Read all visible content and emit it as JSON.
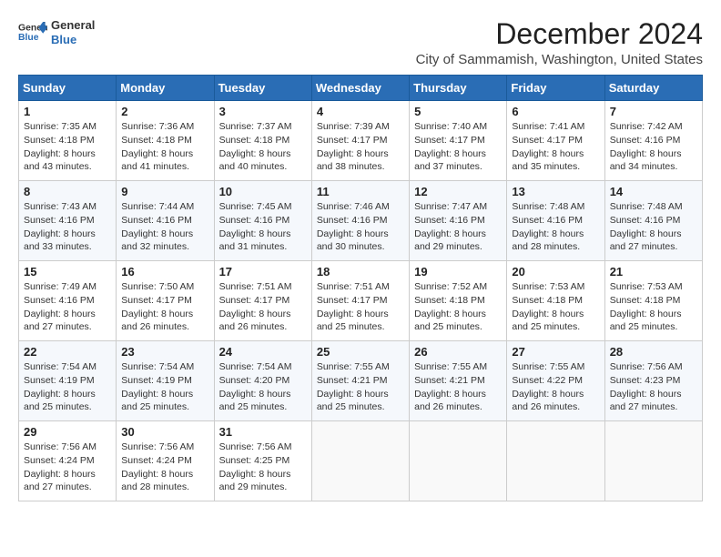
{
  "logo": {
    "line1": "General",
    "line2": "Blue"
  },
  "title": "December 2024",
  "subtitle": "City of Sammamish, Washington, United States",
  "weekdays": [
    "Sunday",
    "Monday",
    "Tuesday",
    "Wednesday",
    "Thursday",
    "Friday",
    "Saturday"
  ],
  "weeks": [
    [
      {
        "day": "1",
        "sunrise": "7:35 AM",
        "sunset": "4:18 PM",
        "daylight": "8 hours and 43 minutes."
      },
      {
        "day": "2",
        "sunrise": "7:36 AM",
        "sunset": "4:18 PM",
        "daylight": "8 hours and 41 minutes."
      },
      {
        "day": "3",
        "sunrise": "7:37 AM",
        "sunset": "4:18 PM",
        "daylight": "8 hours and 40 minutes."
      },
      {
        "day": "4",
        "sunrise": "7:39 AM",
        "sunset": "4:17 PM",
        "daylight": "8 hours and 38 minutes."
      },
      {
        "day": "5",
        "sunrise": "7:40 AM",
        "sunset": "4:17 PM",
        "daylight": "8 hours and 37 minutes."
      },
      {
        "day": "6",
        "sunrise": "7:41 AM",
        "sunset": "4:17 PM",
        "daylight": "8 hours and 35 minutes."
      },
      {
        "day": "7",
        "sunrise": "7:42 AM",
        "sunset": "4:16 PM",
        "daylight": "8 hours and 34 minutes."
      }
    ],
    [
      {
        "day": "8",
        "sunrise": "7:43 AM",
        "sunset": "4:16 PM",
        "daylight": "8 hours and 33 minutes."
      },
      {
        "day": "9",
        "sunrise": "7:44 AM",
        "sunset": "4:16 PM",
        "daylight": "8 hours and 32 minutes."
      },
      {
        "day": "10",
        "sunrise": "7:45 AM",
        "sunset": "4:16 PM",
        "daylight": "8 hours and 31 minutes."
      },
      {
        "day": "11",
        "sunrise": "7:46 AM",
        "sunset": "4:16 PM",
        "daylight": "8 hours and 30 minutes."
      },
      {
        "day": "12",
        "sunrise": "7:47 AM",
        "sunset": "4:16 PM",
        "daylight": "8 hours and 29 minutes."
      },
      {
        "day": "13",
        "sunrise": "7:48 AM",
        "sunset": "4:16 PM",
        "daylight": "8 hours and 28 minutes."
      },
      {
        "day": "14",
        "sunrise": "7:48 AM",
        "sunset": "4:16 PM",
        "daylight": "8 hours and 27 minutes."
      }
    ],
    [
      {
        "day": "15",
        "sunrise": "7:49 AM",
        "sunset": "4:16 PM",
        "daylight": "8 hours and 27 minutes."
      },
      {
        "day": "16",
        "sunrise": "7:50 AM",
        "sunset": "4:17 PM",
        "daylight": "8 hours and 26 minutes."
      },
      {
        "day": "17",
        "sunrise": "7:51 AM",
        "sunset": "4:17 PM",
        "daylight": "8 hours and 26 minutes."
      },
      {
        "day": "18",
        "sunrise": "7:51 AM",
        "sunset": "4:17 PM",
        "daylight": "8 hours and 25 minutes."
      },
      {
        "day": "19",
        "sunrise": "7:52 AM",
        "sunset": "4:18 PM",
        "daylight": "8 hours and 25 minutes."
      },
      {
        "day": "20",
        "sunrise": "7:53 AM",
        "sunset": "4:18 PM",
        "daylight": "8 hours and 25 minutes."
      },
      {
        "day": "21",
        "sunrise": "7:53 AM",
        "sunset": "4:18 PM",
        "daylight": "8 hours and 25 minutes."
      }
    ],
    [
      {
        "day": "22",
        "sunrise": "7:54 AM",
        "sunset": "4:19 PM",
        "daylight": "8 hours and 25 minutes."
      },
      {
        "day": "23",
        "sunrise": "7:54 AM",
        "sunset": "4:19 PM",
        "daylight": "8 hours and 25 minutes."
      },
      {
        "day": "24",
        "sunrise": "7:54 AM",
        "sunset": "4:20 PM",
        "daylight": "8 hours and 25 minutes."
      },
      {
        "day": "25",
        "sunrise": "7:55 AM",
        "sunset": "4:21 PM",
        "daylight": "8 hours and 25 minutes."
      },
      {
        "day": "26",
        "sunrise": "7:55 AM",
        "sunset": "4:21 PM",
        "daylight": "8 hours and 26 minutes."
      },
      {
        "day": "27",
        "sunrise": "7:55 AM",
        "sunset": "4:22 PM",
        "daylight": "8 hours and 26 minutes."
      },
      {
        "day": "28",
        "sunrise": "7:56 AM",
        "sunset": "4:23 PM",
        "daylight": "8 hours and 27 minutes."
      }
    ],
    [
      {
        "day": "29",
        "sunrise": "7:56 AM",
        "sunset": "4:24 PM",
        "daylight": "8 hours and 27 minutes."
      },
      {
        "day": "30",
        "sunrise": "7:56 AM",
        "sunset": "4:24 PM",
        "daylight": "8 hours and 28 minutes."
      },
      {
        "day": "31",
        "sunrise": "7:56 AM",
        "sunset": "4:25 PM",
        "daylight": "8 hours and 29 minutes."
      },
      null,
      null,
      null,
      null
    ]
  ],
  "labels": {
    "sunrise": "Sunrise:",
    "sunset": "Sunset:",
    "daylight": "Daylight:"
  }
}
